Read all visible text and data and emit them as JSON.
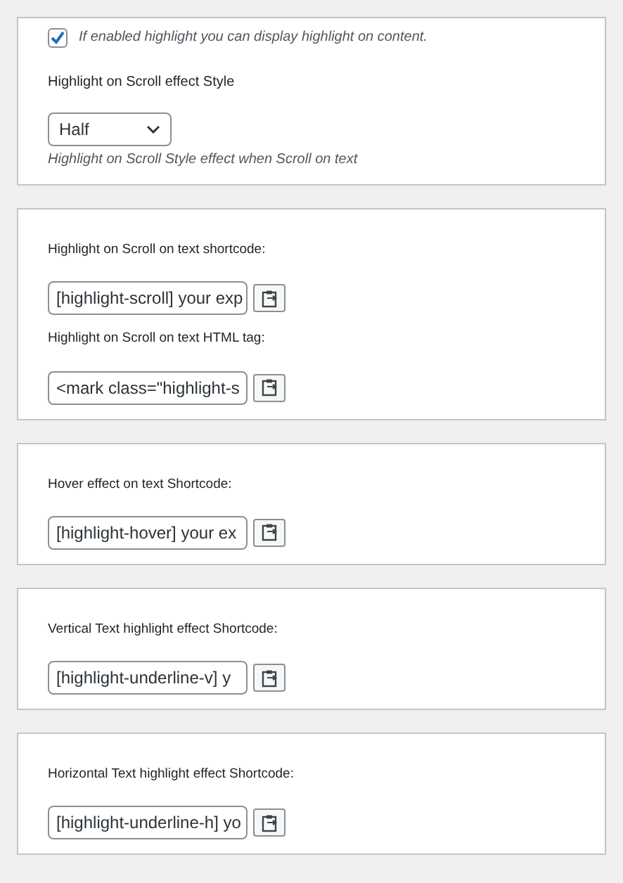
{
  "sections": [
    {
      "items": [
        {
          "kind": "checkbox",
          "label": "If enabled highlight you can display highlight on content.",
          "checked": true
        },
        {
          "kind": "select",
          "label": "Highlight on Scroll effect Style",
          "value": "Half",
          "help": "Highlight on Scroll Style effect when Scroll on text"
        }
      ]
    },
    {
      "items": [
        {
          "kind": "shortcode",
          "label": "Highlight on Scroll on text shortcode:",
          "value": "[highlight-scroll] your exp"
        },
        {
          "kind": "shortcode",
          "label": "Highlight on Scroll on text HTML tag:",
          "value": "<mark class=\"highlight-s"
        }
      ]
    },
    {
      "items": [
        {
          "kind": "shortcode",
          "label": "Hover effect on text Shortcode:",
          "value": "[highlight-hover] your ex"
        }
      ]
    },
    {
      "items": [
        {
          "kind": "shortcode",
          "label": "Vertical Text highlight effect Shortcode:",
          "value": "[highlight-underline-v] y"
        }
      ]
    },
    {
      "items": [
        {
          "kind": "shortcode",
          "label": "Horizontal Text highlight effect Shortcode:",
          "value": "[highlight-underline-h] yo"
        }
      ]
    }
  ]
}
